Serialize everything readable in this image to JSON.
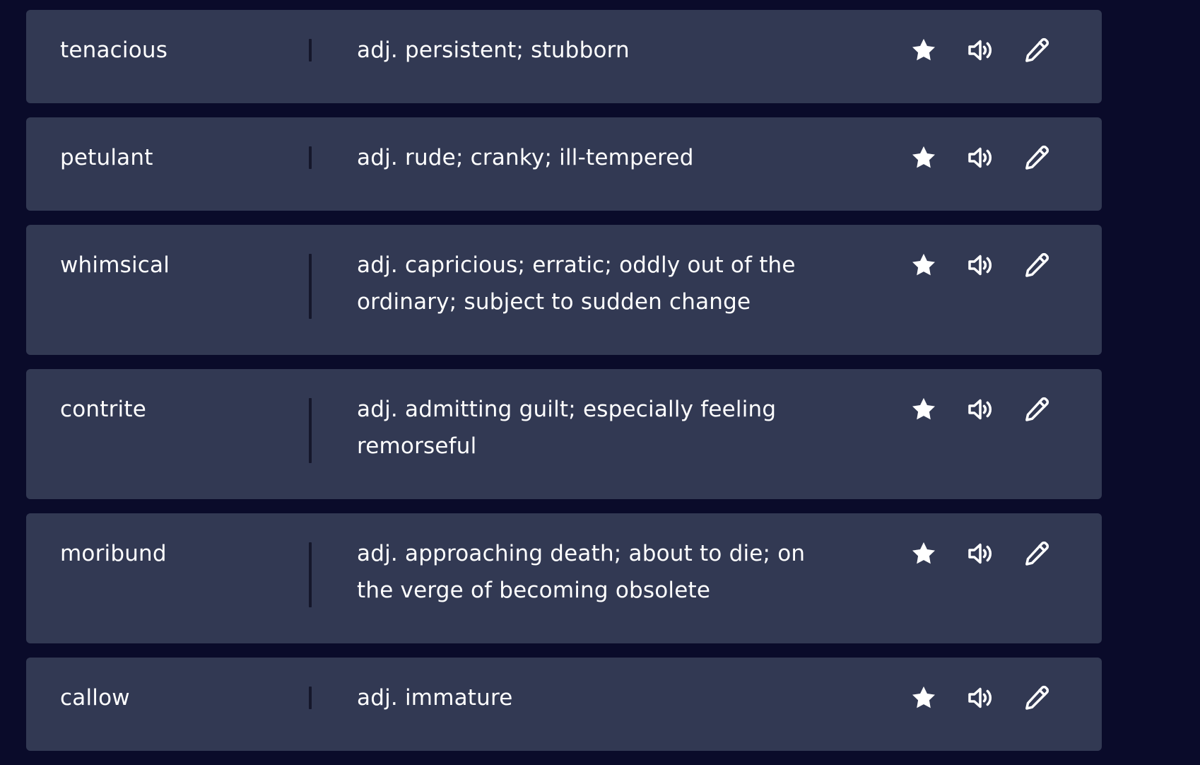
{
  "cards": [
    {
      "term": "tenacious",
      "definition": "adj. persistent; stubborn"
    },
    {
      "term": "petulant",
      "definition": "adj. rude; cranky; ill-tempered"
    },
    {
      "term": "whimsical",
      "definition": "adj. capricious; erratic; oddly out of the ordinary; subject to sudden change"
    },
    {
      "term": "contrite",
      "definition": "adj. admitting guilt; especially feeling remorseful"
    },
    {
      "term": "moribund",
      "definition": "adj. approaching death; about to die; on the verge of becoming obsolete"
    },
    {
      "term": "callow",
      "definition": "adj. immature"
    }
  ],
  "icons": {
    "star": "star-icon",
    "audio": "speaker-icon",
    "edit": "pencil-icon"
  },
  "colors": {
    "background": "#0a0b2a",
    "card": "#323953",
    "text": "#ffffff",
    "divider": "#15172b"
  }
}
